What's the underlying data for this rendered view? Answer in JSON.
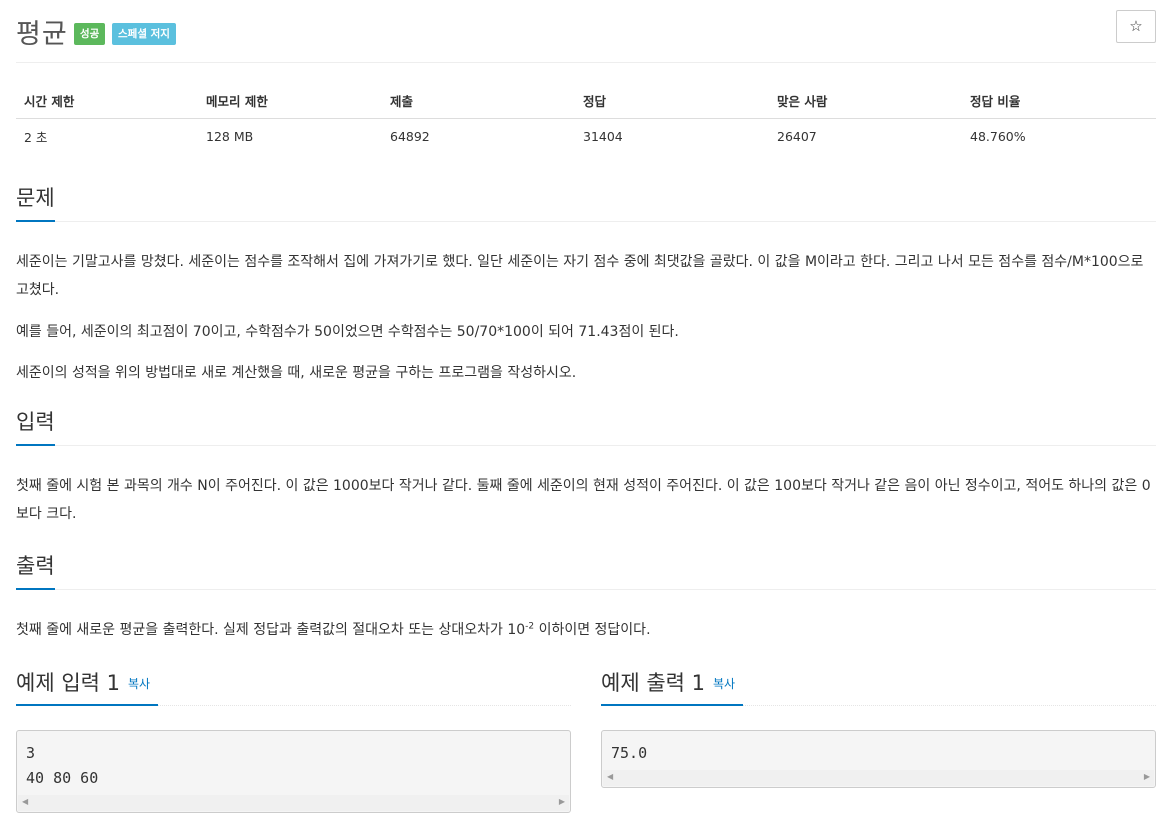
{
  "problem": {
    "title": "평균",
    "badges": {
      "success": "성공",
      "judge": "스페셜 저지"
    },
    "star_icon": "☆"
  },
  "info": {
    "headers": [
      "시간 제한",
      "메모리 제한",
      "제출",
      "정답",
      "맞은 사람",
      "정답 비율"
    ],
    "values": [
      "2 초",
      "128 MB",
      "64892",
      "31404",
      "26407",
      "48.760%"
    ]
  },
  "sections": {
    "description": {
      "title": "문제",
      "paragraphs": [
        "세준이는 기말고사를 망쳤다. 세준이는 점수를 조작해서 집에 가져가기로 했다. 일단 세준이는 자기 점수 중에 최댓값을 골랐다. 이 값을 M이라고 한다. 그리고 나서 모든 점수를 점수/M*100으로 고쳤다.",
        "예를 들어, 세준이의 최고점이 70이고, 수학점수가 50이었으면 수학점수는 50/70*100이 되어 71.43점이 된다.",
        "세준이의 성적을 위의 방법대로 새로 계산했을 때, 새로운 평균을 구하는 프로그램을 작성하시오."
      ]
    },
    "input": {
      "title": "입력",
      "text": "첫째 줄에 시험 본 과목의 개수 N이 주어진다. 이 값은 1000보다 작거나 같다. 둘째 줄에 세준이의 현재 성적이 주어진다. 이 값은 100보다 작거나 같은 음이 아닌 정수이고, 적어도 하나의 값은 0보다 크다."
    },
    "output": {
      "title": "출력",
      "text_before": "첫째 줄에 새로운 평균을 출력한다. 실제 정답과 출력값의 절대오차 또는 상대오차가 10",
      "exponent": "-2",
      "text_after": " 이하이면 정답이다."
    }
  },
  "samples": {
    "input": {
      "title": "예제 입력 1",
      "copy": "복사",
      "content": "3\n40 80 60"
    },
    "output": {
      "title": "예제 출력 1",
      "copy": "복사",
      "content": "75.0"
    }
  }
}
